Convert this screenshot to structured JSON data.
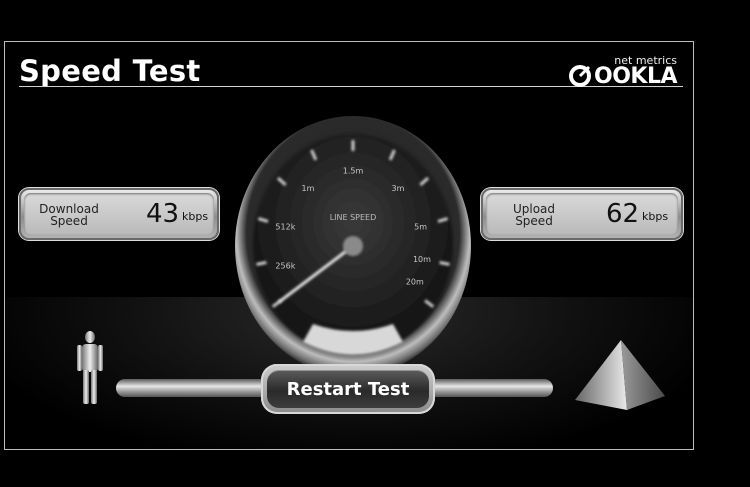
{
  "app": {
    "title": "Speed Test"
  },
  "logo": {
    "tagline": "net metrics",
    "brand": "OOKLA"
  },
  "download": {
    "label_line1": "Download",
    "label_line2": "Speed",
    "value": "43",
    "unit": "kbps"
  },
  "upload": {
    "label_line1": "Upload",
    "label_line2": "Speed",
    "value": "62",
    "unit": "kbps"
  },
  "gauge": {
    "title": "LINE SPEED",
    "ticks": [
      "256k",
      "512k",
      "1m",
      "1.5m",
      "3m",
      "5m",
      "10m",
      "20m"
    ]
  },
  "actions": {
    "restart_label": "Restart Test"
  },
  "colors": {
    "background": "#000000",
    "frame_border": "#bdbdbd",
    "text": "#ffffff"
  },
  "icons": {
    "client": "person-icon",
    "server": "pyramid-icon"
  }
}
